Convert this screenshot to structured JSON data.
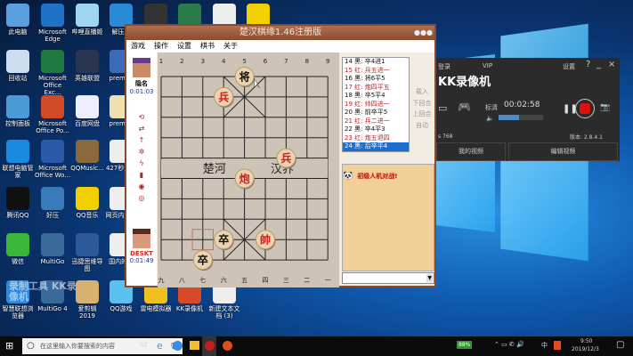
{
  "desktop": {
    "icons": [
      {
        "label": "此电脑",
        "c": "#5aa0e0"
      },
      {
        "label": "Microsoft Edge",
        "c": "#1e73c8"
      },
      {
        "label": "哔哩直播姬",
        "c": "#9fd4f4"
      },
      {
        "label": "解压发",
        "c": "#2a8ad8"
      },
      {
        "label": "",
        "c": "#333"
      },
      {
        "label": "",
        "c": "#2a7a4a"
      },
      {
        "label": "",
        "c": "#eee"
      },
      {
        "label": "",
        "c": "#f2d000"
      },
      {
        "label": "回收站",
        "c": "#cde"
      },
      {
        "label": "Microsoft Office Exc...",
        "c": "#1e7a3e"
      },
      {
        "label": "英雄联盟",
        "c": "#2a3550"
      },
      {
        "label": "premi...",
        "c": "#3a6ab8"
      },
      {
        "label": "控制面板",
        "c": "#4a9ad8"
      },
      {
        "label": "Microsoft Office Po...",
        "c": "#d24a26"
      },
      {
        "label": "百度网盘",
        "c": "#eef"
      },
      {
        "label": "premi...",
        "c": "#f0e0b0"
      },
      {
        "label": "联想电脑管家",
        "c": "#1a8ae0"
      },
      {
        "label": "Microsoft Office Wo...",
        "c": "#2a5aa8"
      },
      {
        "label": "QQMusic...",
        "c": "#8a6a3a"
      },
      {
        "label": "427秒杀...",
        "c": "#eee"
      },
      {
        "label": "腾讯QQ",
        "c": "#111"
      },
      {
        "label": "好压",
        "c": "#3a7ab8"
      },
      {
        "label": "QQ音乐",
        "c": "#f2d000"
      },
      {
        "label": "网页内容...",
        "c": "#eee"
      },
      {
        "label": "微信",
        "c": "#3ab83a"
      },
      {
        "label": "MultiGo",
        "c": "#3a6a9a"
      },
      {
        "label": "迅捷思维导图",
        "c": "#2a5a9a"
      },
      {
        "label": "国内的...",
        "c": "#eee"
      },
      {
        "label": "智慧联想浏览器",
        "c": "#2a8ae0"
      },
      {
        "label": "MultiGo 4",
        "c": "#3a6a9a"
      },
      {
        "label": "爱剪辑 2019",
        "c": "#d8b070"
      },
      {
        "label": "QQ游戏",
        "c": "#5ac0f0"
      },
      {
        "label": "雷电模拟器",
        "c": "#f0c020"
      },
      {
        "label": "KK录像机",
        "c": "#d84a2a"
      },
      {
        "label": "新建文本文档 (3)",
        "c": "#eee"
      }
    ],
    "watermark": "录制工具 KK录像机"
  },
  "chess": {
    "title": "楚汉棋缘1.46注册版",
    "menu": [
      "游戏",
      "操作",
      "设置",
      "棋书",
      "关于"
    ],
    "top_player": {
      "name": "隐名",
      "time": "0:01:03"
    },
    "bottom_player": {
      "name": "DESKT",
      "time": "0:01:49"
    },
    "top_files": [
      "1",
      "2",
      "3",
      "4",
      "5",
      "6",
      "7",
      "8",
      "9"
    ],
    "bottom_files": [
      "九",
      "八",
      "七",
      "六",
      "五",
      "四",
      "三",
      "二",
      "一"
    ],
    "river": [
      "楚河",
      "汉界"
    ],
    "pieces": [
      {
        "ch": "将",
        "side": "black",
        "file": 5,
        "rank": 0
      },
      {
        "ch": "兵",
        "side": "red",
        "file": 4,
        "rank": 1
      },
      {
        "ch": "兵",
        "side": "red",
        "file": 7,
        "rank": 4
      },
      {
        "ch": "炮",
        "side": "red",
        "file": 5,
        "rank": 5
      },
      {
        "ch": "卒",
        "side": "black",
        "file": 4,
        "rank": 8
      },
      {
        "ch": "帥",
        "side": "red",
        "file": 6,
        "rank": 8
      },
      {
        "ch": "卒",
        "side": "black",
        "file": 3,
        "rank": 9
      }
    ],
    "last_move_from": {
      "file": 3,
      "rank": 8
    },
    "moves": [
      {
        "t": "14 黑: 卒4进1",
        "side": "black"
      },
      {
        "t": "15 红: 兵五进一",
        "side": "red"
      },
      {
        "t": "16 黑: 将6平5",
        "side": "black"
      },
      {
        "t": "17 红: 炮四平五",
        "side": "red"
      },
      {
        "t": "18 黑: 卒5平4",
        "side": "black"
      },
      {
        "t": "19 红: 帅四进一",
        "side": "red"
      },
      {
        "t": "20 黑: 前卒平5",
        "side": "black"
      },
      {
        "t": "21 红: 兵二进一",
        "side": "red"
      },
      {
        "t": "22 黑: 卒4平3",
        "side": "black"
      },
      {
        "t": "23 红: 炮五退四",
        "side": "red"
      },
      {
        "t": "24 黑: 后卒平4",
        "side": "black",
        "selected": true
      }
    ],
    "buttons": [
      "载入",
      "下回合",
      "上回合",
      "自动"
    ],
    "chat": "初级人机对战!"
  },
  "kk": {
    "login": "登录",
    "vip": "VIP",
    "settings": "设置",
    "title": "KK录像机",
    "rec_label": "标清",
    "timer": "00:02:58",
    "left_info": "s 768",
    "version": "版本: 2.8.4.1",
    "my_videos": "我的视频",
    "edit_video": "编辑视频",
    "record_color": "#e01010"
  },
  "taskbar": {
    "search_placeholder": "在这里输入你要搜索的内容",
    "battery": "88%",
    "ime": "中",
    "time": "9:50",
    "date": "2019/12/3"
  }
}
